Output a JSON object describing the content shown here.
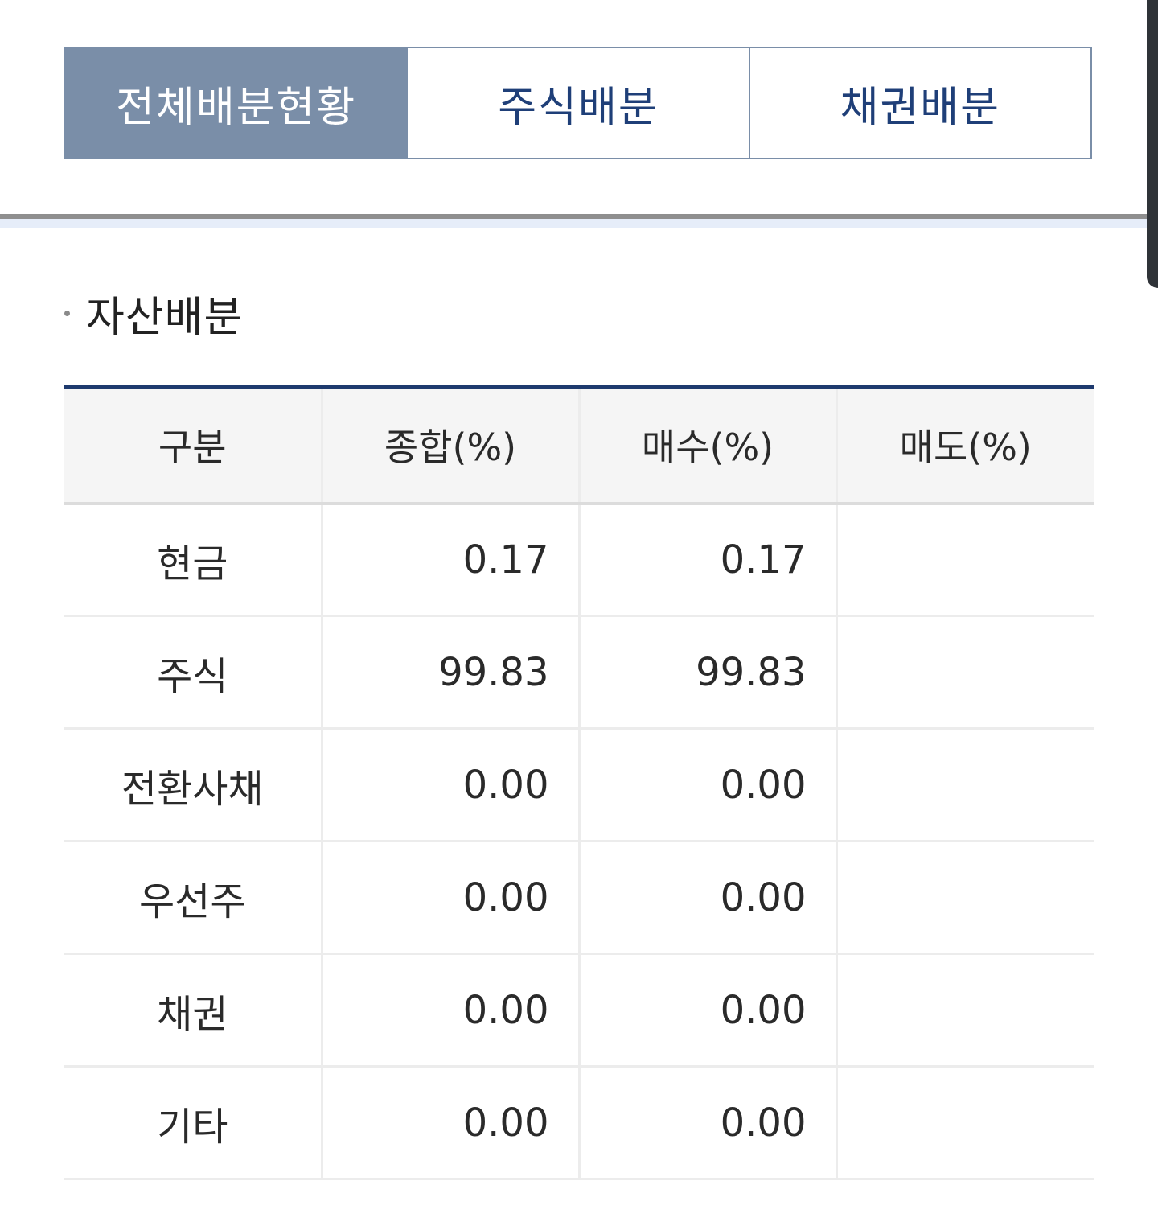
{
  "tabs": [
    {
      "label": "전체배분현황",
      "active": true
    },
    {
      "label": "주식배분",
      "active": false
    },
    {
      "label": "채권배분",
      "active": false
    }
  ],
  "section": {
    "title": "자산배분"
  },
  "table": {
    "headers": [
      "구분",
      "종합(%)",
      "매수(%)",
      "매도(%)"
    ],
    "rows": [
      [
        "현금",
        "0.17",
        "0.17",
        ""
      ],
      [
        "주식",
        "99.83",
        "99.83",
        ""
      ],
      [
        "전환사채",
        "0.00",
        "0.00",
        ""
      ],
      [
        "우선주",
        "0.00",
        "0.00",
        ""
      ],
      [
        "채권",
        "0.00",
        "0.00",
        ""
      ],
      [
        "기타",
        "0.00",
        "0.00",
        ""
      ]
    ]
  },
  "colors": {
    "tab_active_bg": "#7a8ea8",
    "tab_text": "#1f3f78",
    "table_top_border": "#1e3a6e"
  }
}
